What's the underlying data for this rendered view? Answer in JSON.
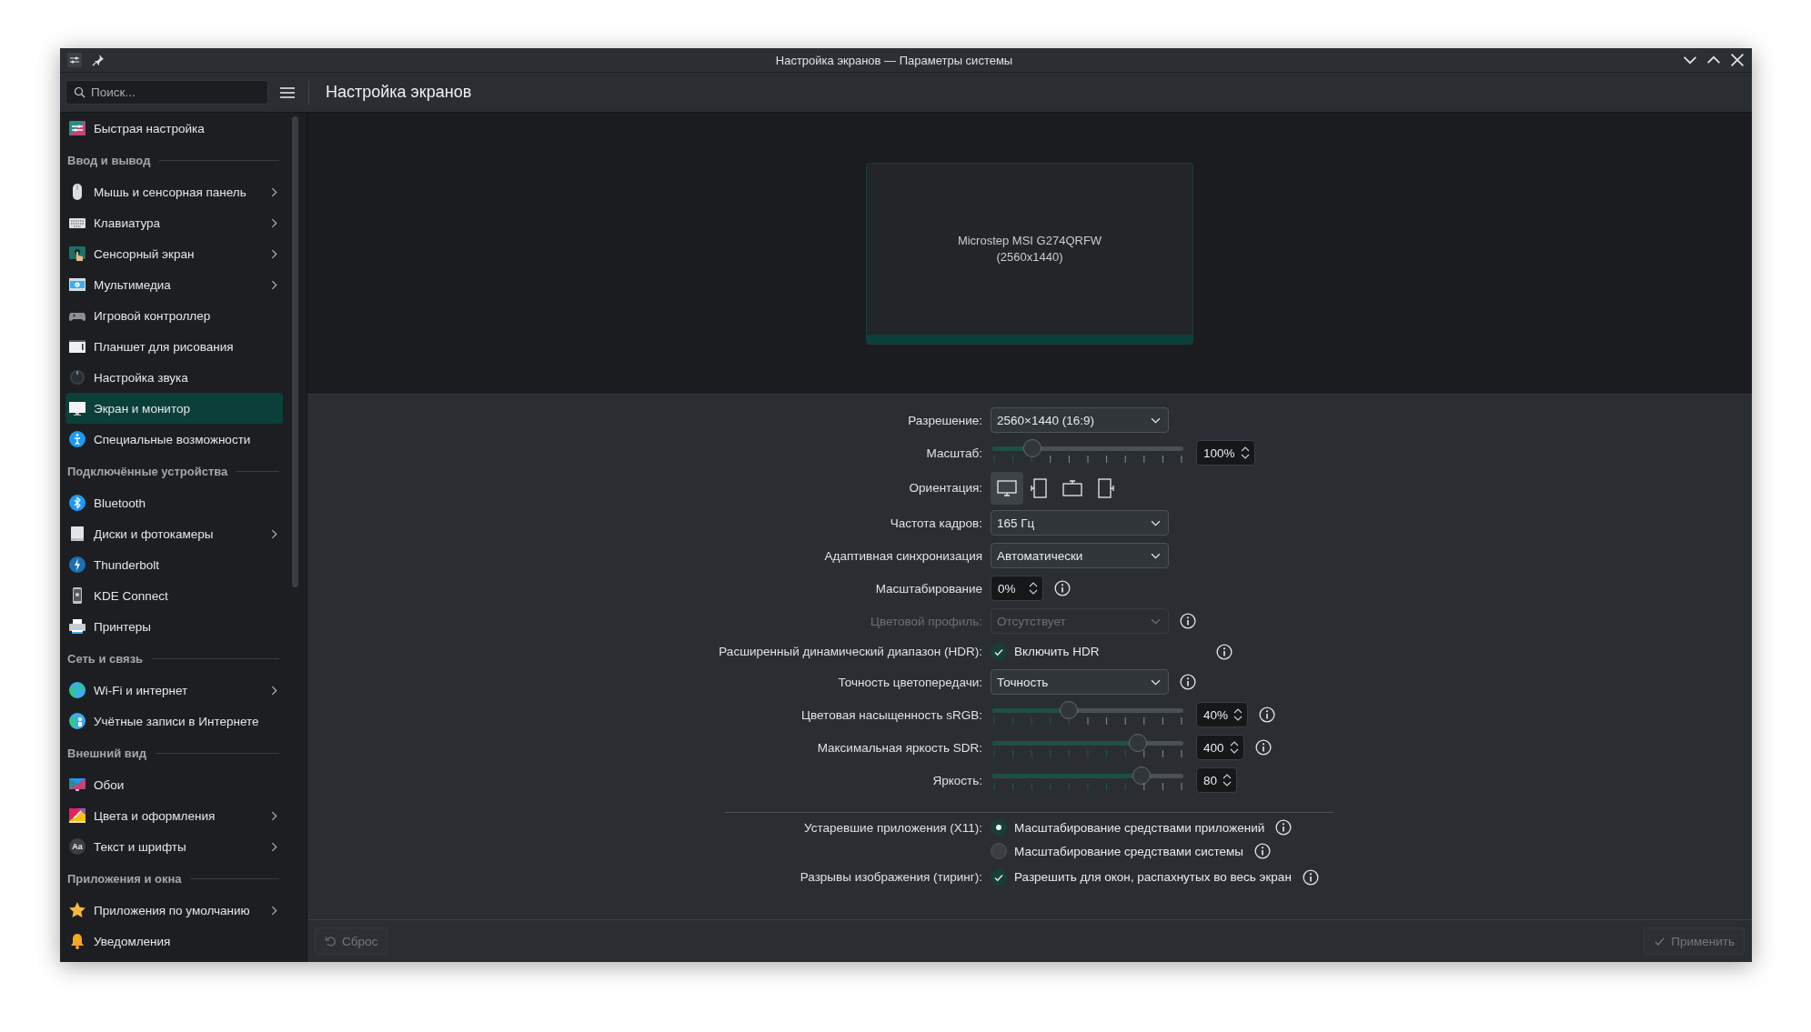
{
  "window": {
    "title": "Настройка экранов — Параметры системы"
  },
  "search": {
    "placeholder": "Поиск..."
  },
  "page_title": "Настройка экранов",
  "sidebar": {
    "groups": [
      {
        "items": [
          {
            "label": "Быстрая настройка",
            "expandable": false,
            "selected": false
          }
        ]
      },
      {
        "heading": "Ввод и вывод",
        "items": [
          {
            "label": "Мышь и сенсорная панель",
            "expandable": true,
            "selected": false
          },
          {
            "label": "Клавиатура",
            "expandable": true,
            "selected": false
          },
          {
            "label": "Сенсорный экран",
            "expandable": true,
            "selected": false
          },
          {
            "label": "Мультимедиа",
            "expandable": true,
            "selected": false
          },
          {
            "label": "Игровой контроллер",
            "expandable": false,
            "selected": false
          },
          {
            "label": "Планшет для рисования",
            "expandable": false,
            "selected": false
          },
          {
            "label": "Настройка звука",
            "expandable": false,
            "selected": false
          },
          {
            "label": "Экран и монитор",
            "expandable": false,
            "selected": true
          },
          {
            "label": "Специальные возможности",
            "expandable": false,
            "selected": false
          }
        ]
      },
      {
        "heading": "Подключённые устройства",
        "items": [
          {
            "label": "Bluetooth",
            "expandable": false,
            "selected": false
          },
          {
            "label": "Диски и фотокамеры",
            "expandable": true,
            "selected": false
          },
          {
            "label": "Thunderbolt",
            "expandable": false,
            "selected": false
          },
          {
            "label": "KDE Connect",
            "expandable": false,
            "selected": false
          },
          {
            "label": "Принтеры",
            "expandable": false,
            "selected": false
          }
        ]
      },
      {
        "heading": "Сеть и связь",
        "items": [
          {
            "label": "Wi-Fi и интернет",
            "expandable": true,
            "selected": false
          },
          {
            "label": "Учётные записи в Интернете",
            "expandable": false,
            "selected": false
          }
        ]
      },
      {
        "heading": "Внешний вид",
        "items": [
          {
            "label": "Обои",
            "expandable": false,
            "selected": false
          },
          {
            "label": "Цвета и оформления",
            "expandable": true,
            "selected": false
          },
          {
            "label": "Текст и шрифты",
            "expandable": true,
            "selected": false,
            "icon_text": "Aa"
          }
        ]
      },
      {
        "heading": "Приложения и окна",
        "items": [
          {
            "label": "Приложения по умолчанию",
            "expandable": true,
            "selected": false
          },
          {
            "label": "Уведомления",
            "expandable": false,
            "selected": false
          }
        ]
      }
    ]
  },
  "monitor": {
    "name": "Microstep MSI G274QRFW",
    "resolution": "(2560x1440)"
  },
  "settings": [
    {
      "label": "Разрешение:",
      "kind": "dropdown",
      "value": "2560×1440 (16:9)",
      "disabled": false,
      "info": false
    },
    {
      "label": "Масштаб:",
      "kind": "slider",
      "level": 0.21,
      "reading": "100%",
      "info": false
    },
    {
      "label": "Ориентация:",
      "kind": "orientation",
      "options": [
        {
          "selected": true
        },
        {
          "selected": false
        },
        {
          "selected": false
        },
        {
          "selected": false
        }
      ],
      "info": false
    },
    {
      "label": "Частота кадров:",
      "kind": "dropdown",
      "value": "165 Гц",
      "disabled": false,
      "info": false
    },
    {
      "label": "Адаптивная синхронизация",
      "kind": "dropdown",
      "value": "Автоматически",
      "disabled": false,
      "info": false
    },
    {
      "label": "Масштабирование",
      "kind": "spin",
      "value": "0%",
      "info": true
    },
    {
      "label": "Цветовой профиль:",
      "kind": "dropdown",
      "value": "Отсутствует",
      "disabled": true,
      "info": true
    },
    {
      "label": "Расширенный динамический диапазон (HDR):",
      "kind": "checkbox",
      "text": "Включить HDR",
      "checked": true,
      "info": true
    },
    {
      "label": "Точность цветопередачи:",
      "kind": "dropdown",
      "value": "Точность",
      "disabled": false,
      "info": true
    },
    {
      "label": "Цветовая насыщенность sRGB:",
      "kind": "slider",
      "level": 0.4,
      "reading": "40%",
      "info": true
    },
    {
      "label": "Максимальная яркость SDR:",
      "kind": "slider",
      "level": 0.76,
      "reading": "400",
      "info": true
    },
    {
      "label": "Яркость:",
      "kind": "slider",
      "level": 0.78,
      "reading": "80",
      "info": false
    },
    {
      "kind": "separator"
    },
    {
      "label": "Устаревшие приложения (X11):",
      "kind": "radio",
      "options": [
        {
          "text": "Масштабирование средствами приложений",
          "selected": true,
          "info": true
        },
        {
          "text": "Масштабирование средствами системы",
          "selected": false,
          "info": true
        }
      ]
    },
    {
      "label": "Разрывы изображения (тиринг):",
      "kind": "checkbox",
      "text": "Разрешить для окон, распахнутых во весь экран",
      "checked": true,
      "info": true
    }
  ],
  "buttons": [
    {
      "kind": "reset",
      "label": "Сброс",
      "disabled": true
    },
    {
      "kind": "apply",
      "label": "Применить",
      "disabled": true
    }
  ]
}
